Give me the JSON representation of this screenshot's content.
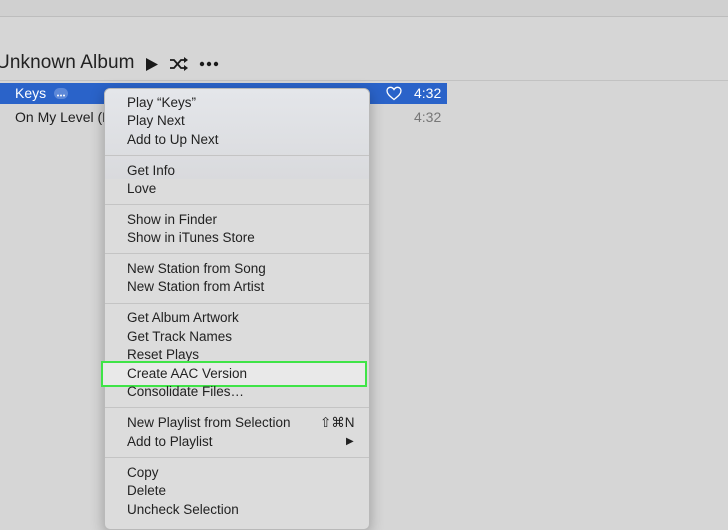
{
  "album": {
    "title": "Unknown Album",
    "controls": [
      "play-icon",
      "shuffle-icon",
      "more-icon"
    ]
  },
  "tracks": [
    {
      "name": "Keys",
      "time": "4:32",
      "selected": true
    },
    {
      "name": "On My Level (F",
      "time": "4:32",
      "selected": false
    }
  ],
  "context_menu": {
    "groups": [
      [
        "Play “Keys”",
        "Play Next",
        "Add to Up Next"
      ],
      [
        "Get Info",
        "Love"
      ],
      [
        "Show in Finder",
        "Show in iTunes Store"
      ],
      [
        "New Station from Song",
        "New Station from Artist"
      ],
      [
        "Get Album Artwork",
        "Get Track Names",
        "Reset Plays",
        "Create AAC Version",
        "Consolidate Files…"
      ],
      [
        "New Playlist from Selection",
        "Add to Playlist"
      ],
      [
        "Copy",
        "Delete",
        "Uncheck Selection"
      ]
    ],
    "shortcuts": {
      "new_playlist": "⇧⌘N"
    },
    "highlighted_item": "Create AAC Version"
  },
  "colors": {
    "selection_blue": "#2a63c9",
    "highlight_green": "#3fe447"
  }
}
